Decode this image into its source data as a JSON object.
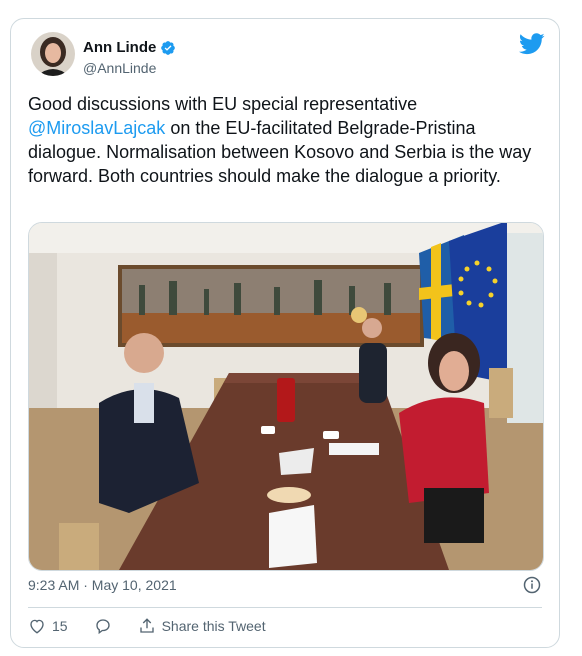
{
  "author": {
    "name": "Ann Linde",
    "handle": "@AnnLinde"
  },
  "tweet": {
    "text_before": "Good discussions with EU special representative ",
    "mention": "@MiroslavLajcak",
    "text_after": " on the EU-facilitated Belgrade-Pristina dialogue. Normalisation between Kosovo and Serbia is the way forward. Both countries should make the dialogue a priority."
  },
  "meta": {
    "timestamp": "9:23 AM · May 10, 2021"
  },
  "actions": {
    "like_count": "15",
    "share_label": "Share this Tweet"
  },
  "icons": {
    "twitter": "twitter-bird-icon",
    "verified": "verified-badge-icon",
    "info": "info-icon",
    "like": "heart-icon",
    "reply": "reply-icon",
    "share": "share-icon"
  },
  "colors": {
    "accent": "#1d9bf0",
    "text": "#0f1419",
    "muted": "#536471",
    "border": "#cfd9de"
  }
}
